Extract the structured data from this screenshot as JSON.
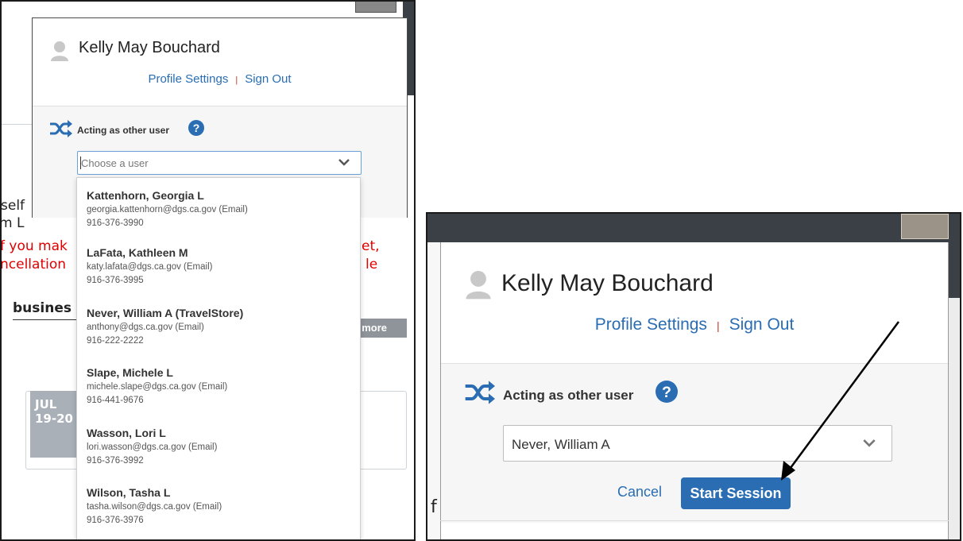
{
  "left_screenshot": {
    "background": {
      "fragments": [
        "self",
        "m L",
        "f you mak",
        "ncellation",
        "et,",
        "le",
        "busines"
      ],
      "more_button": "l more",
      "date": {
        "month": "JUL",
        "days": "19-20"
      }
    },
    "profile_menu": {
      "user_name": "Kelly May Bouchard",
      "profile_settings_link": "Profile Settings",
      "separator": "|",
      "sign_out_link": "Sign Out",
      "acting_label": "Acting as other user",
      "select_placeholder": "Choose a user"
    },
    "user_options": [
      {
        "name": "Kattenhorn, Georgia L",
        "email": "georgia.kattenhorn@dgs.ca.gov (Email)",
        "phone": "916-376-3990"
      },
      {
        "name": "LaFata, Kathleen M",
        "email": "katy.lafata@dgs.ca.gov (Email)",
        "phone": "916-376-3995"
      },
      {
        "name": "Never, William A (TravelStore)",
        "email": "anthony@dgs.ca.gov (Email)",
        "phone": "916-222-2222"
      },
      {
        "name": "Slape, Michele L",
        "email": "michele.slape@dgs.ca.gov (Email)",
        "phone": "916-441-9676"
      },
      {
        "name": "Wasson, Lori L",
        "email": "lori.wasson@dgs.ca.gov (Email)",
        "phone": "916-376-3992"
      },
      {
        "name": "Wilson, Tasha L",
        "email": "tasha.wilson@dgs.ca.gov (Email)",
        "phone": "916-376-3976"
      }
    ]
  },
  "right_screenshot": {
    "profile_menu": {
      "user_name": "Kelly May Bouchard",
      "profile_settings_link": "Profile Settings",
      "separator": "|",
      "sign_out_link": "Sign Out",
      "acting_label": "Acting as other user",
      "selected_user": "Never, William A",
      "cancel_button": "Cancel",
      "start_session_button": "Start Session"
    },
    "background_fragment": "f"
  },
  "colors": {
    "link_blue": "#2a6db3",
    "button_blue": "#2a6db3",
    "header_dark": "#3b4047",
    "warning_red": "#e00000"
  },
  "icons": [
    "user-avatar-icon",
    "shuffle-icon",
    "help-circle-icon",
    "chevron-down-icon",
    "annotation-arrow"
  ]
}
